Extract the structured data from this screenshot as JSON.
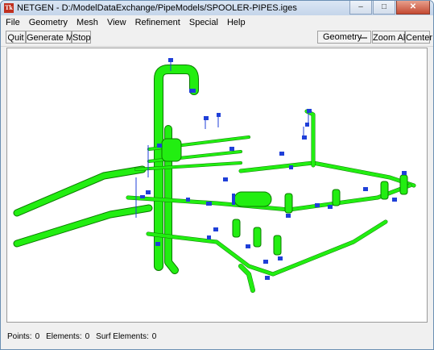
{
  "window": {
    "title": "NETGEN - D:/ModelDataExchange/PipeModels/SPOOLER-PIPES.iges",
    "app_icon": "Tk"
  },
  "window_controls": {
    "minimize": "‒",
    "maximize": "□",
    "close": "✕"
  },
  "menu": [
    {
      "label": "File"
    },
    {
      "label": "Geometry"
    },
    {
      "label": "Mesh"
    },
    {
      "label": "View"
    },
    {
      "label": "Refinement"
    },
    {
      "label": "Special"
    },
    {
      "label": "Help"
    }
  ],
  "toolbar": {
    "quit": "Quit",
    "generate_mesh": "Generate Mesh",
    "stop": "Stop",
    "view_mode": "Geometry",
    "zoom_all": "Zoom All",
    "center": "Center"
  },
  "status": {
    "points_label": "Points:",
    "points_value": "0",
    "elements_label": "Elements:",
    "elements_value": "0",
    "surf_label": "Surf Elements:",
    "surf_value": "0"
  },
  "colors": {
    "pipe": "#22ee11",
    "pipe_edge": "#0a7a00",
    "valve_blue": "#1f3fd8",
    "accent_red": "#c03020"
  }
}
